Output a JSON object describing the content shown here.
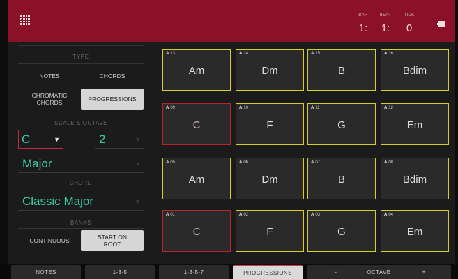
{
  "header": {
    "position": {
      "bar_label": "BAR",
      "bar_value": "1:",
      "beat_label": "BEAT",
      "beat_value": "1:",
      "tick_label": "TICK",
      "tick_value": "0"
    },
    "menu_icon": "grid-menu-icon",
    "battery_icon": "battery-icon"
  },
  "left_panel": {
    "type": {
      "heading": "TYPE",
      "notes": "NOTES",
      "chords": "CHORDS",
      "chromatic_chords_line1": "CHROMATIC",
      "chromatic_chords_line2": "CHORDS",
      "progressions": "PROGRESSIONS",
      "selected": "PROGRESSIONS"
    },
    "scale_octave": {
      "heading": "SCALE & OCTAVE",
      "key": "C",
      "octave": "2",
      "scale": "Major"
    },
    "chord": {
      "heading": "CHORD",
      "value": "Classic Major"
    },
    "banks": {
      "heading": "BANKS",
      "continuous": "CONTINUOUS",
      "start_on_root_line1": "START ON",
      "start_on_root_line2": "ROOT",
      "selected": "START ON ROOT"
    }
  },
  "pads": [
    [
      {
        "bank": "A",
        "num": "13",
        "chord": "Am"
      },
      {
        "bank": "A",
        "num": "14",
        "chord": "Dm"
      },
      {
        "bank": "A",
        "num": "15",
        "chord": "B"
      },
      {
        "bank": "A",
        "num": "16",
        "chord": "Bdim"
      }
    ],
    [
      {
        "bank": "A",
        "num": "09",
        "chord": "C"
      },
      {
        "bank": "A",
        "num": "10",
        "chord": "F"
      },
      {
        "bank": "A",
        "num": "11",
        "chord": "G"
      },
      {
        "bank": "A",
        "num": "12",
        "chord": "Em"
      }
    ],
    [
      {
        "bank": "A",
        "num": "05",
        "chord": "Am"
      },
      {
        "bank": "A",
        "num": "06",
        "chord": "Dm"
      },
      {
        "bank": "A",
        "num": "07",
        "chord": "B"
      },
      {
        "bank": "A",
        "num": "08",
        "chord": "Bdim"
      }
    ],
    [
      {
        "bank": "A",
        "num": "01",
        "chord": "C"
      },
      {
        "bank": "A",
        "num": "02",
        "chord": "F"
      },
      {
        "bank": "A",
        "num": "03",
        "chord": "G"
      },
      {
        "bank": "A",
        "num": "04",
        "chord": "Em"
      }
    ]
  ],
  "colors": {
    "header_bg": "#8a1128",
    "accent_teal": "#3cc9a6",
    "pad_border_yellow": "#d4cf21",
    "pad_border_root_red": "#b8232f"
  },
  "bottom_bar": {
    "tabs": [
      "NOTES",
      "1-3-5",
      "1-3-5-7",
      "PROGRESSIONS"
    ],
    "active_tab": "PROGRESSIONS",
    "octave_label": "OCTAVE",
    "octave_minus": "-",
    "octave_plus": "+"
  }
}
